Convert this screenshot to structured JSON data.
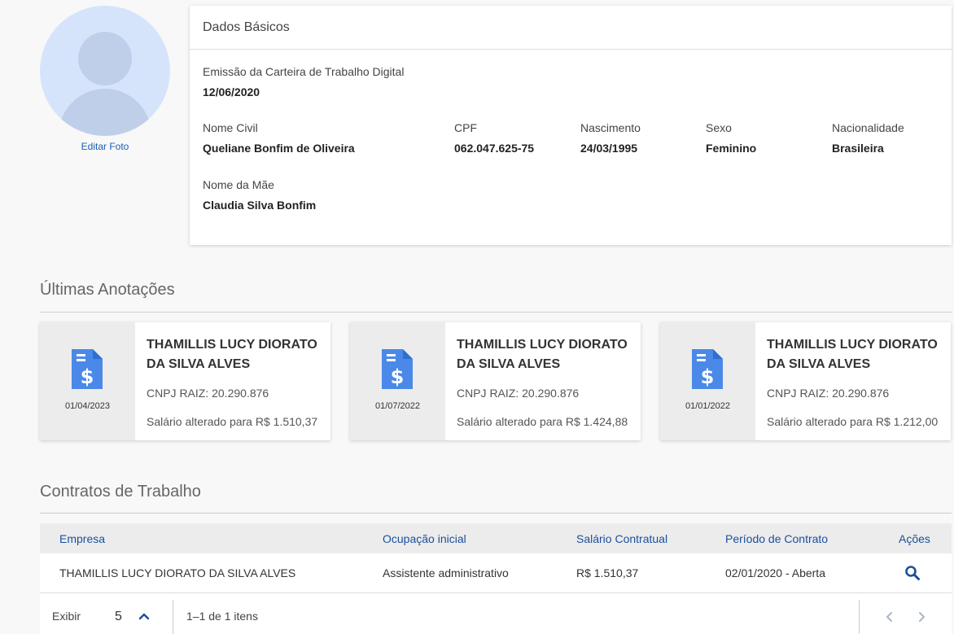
{
  "profile": {
    "edit_photo_label": "Editar Foto"
  },
  "basic_data": {
    "title": "Dados Básicos",
    "emissao_label": "Emissão da Carteira de Trabalho Digital",
    "emissao_value": "12/06/2020",
    "nome_civil_label": "Nome Civil",
    "nome_civil_value": "Queliane Bonfim de Oliveira",
    "cpf_label": "CPF",
    "cpf_value": "062.047.625-75",
    "nascimento_label": "Nascimento",
    "nascimento_value": "24/03/1995",
    "sexo_label": "Sexo",
    "sexo_value": "Feminino",
    "nacionalidade_label": "Nacionalidade",
    "nacionalidade_value": "Brasileira",
    "nome_mae_label": "Nome da Mãe",
    "nome_mae_value": "Claudia Silva Bonfim"
  },
  "annotations": {
    "title": "Últimas Anotações",
    "icon": "salary-document-icon",
    "cards": [
      {
        "date": "01/04/2023",
        "company": "THAMILLIS LUCY DIORATO DA SILVA ALVES",
        "cnpj": "CNPJ RAIZ: 20.290.876",
        "note": "Salário alterado para R$ 1.510,37"
      },
      {
        "date": "01/07/2022",
        "company": "THAMILLIS LUCY DIORATO DA SILVA ALVES",
        "cnpj": "CNPJ RAIZ: 20.290.876",
        "note": "Salário alterado para R$ 1.424,88"
      },
      {
        "date": "01/01/2022",
        "company": "THAMILLIS LUCY DIORATO DA SILVA ALVES",
        "cnpj": "CNPJ RAIZ: 20.290.876",
        "note": "Salário alterado para R$ 1.212,00"
      }
    ]
  },
  "contracts": {
    "title": "Contratos de Trabalho",
    "columns": [
      "Empresa",
      "Ocupação inicial",
      "Salário Contratual",
      "Período de Contrato",
      "Ações"
    ],
    "rows": [
      {
        "empresa": "THAMILLIS LUCY DIORATO DA SILVA ALVES",
        "ocupacao": "Assistente administrativo",
        "salario": "R$ 1.510,37",
        "periodo": "02/01/2020 - Aberta"
      }
    ],
    "pager": {
      "exibir_label": "Exibir",
      "page_size": "5",
      "range_text": "1–1 de 1 itens"
    }
  },
  "colors": {
    "accent": "#1a4f9c",
    "icon_blue": "#4a89e8",
    "avatar_bg": "#d6e4fb"
  }
}
